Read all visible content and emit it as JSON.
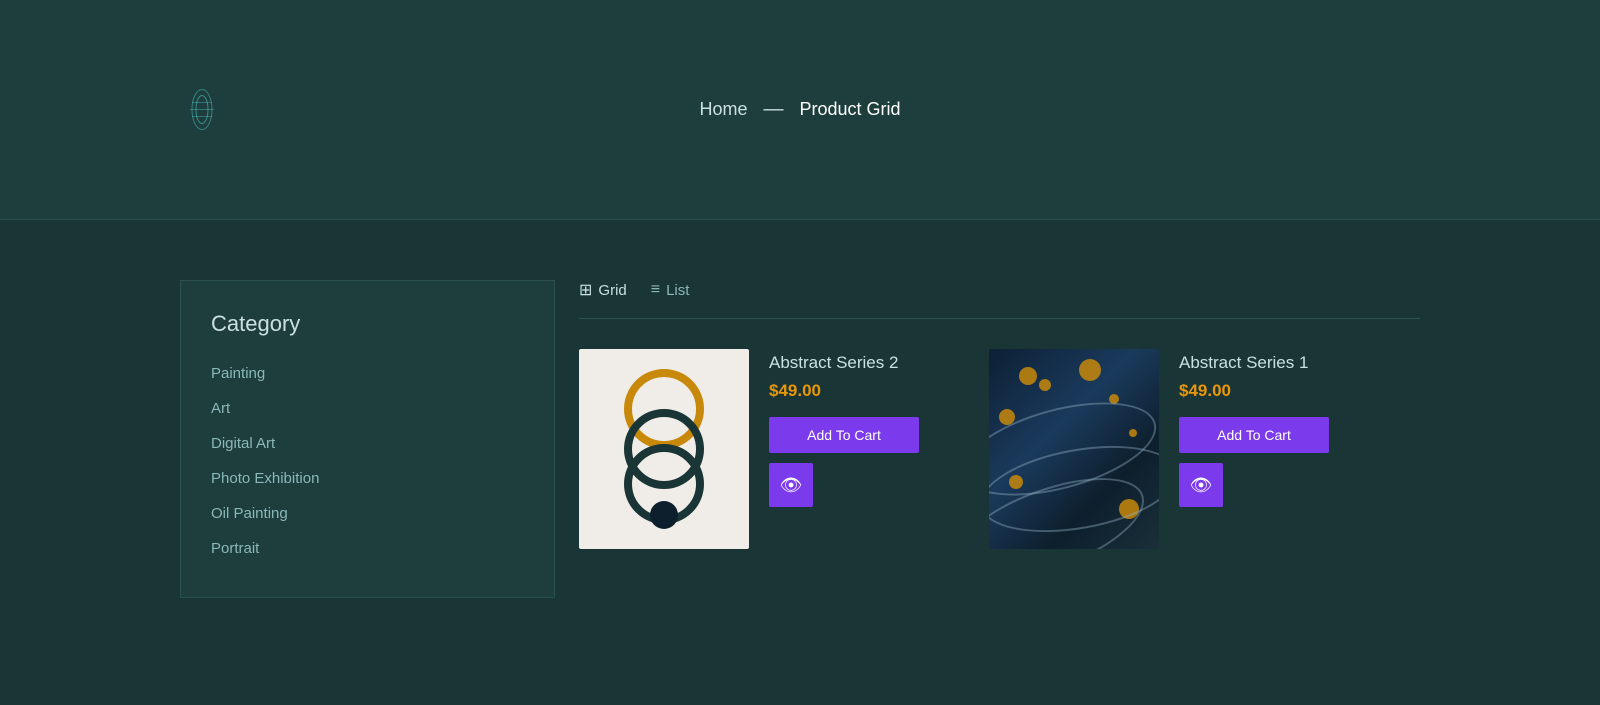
{
  "hero": {
    "logo_alt": "Site Logo",
    "breadcrumb": {
      "home_label": "Home",
      "separator": "—",
      "current_label": "Product Grid"
    }
  },
  "sidebar": {
    "title": "Category",
    "categories": [
      {
        "label": "Painting"
      },
      {
        "label": "Art"
      },
      {
        "label": "Digital Art"
      },
      {
        "label": "Photo Exhibition"
      },
      {
        "label": "Oil Painting"
      },
      {
        "label": "Portrait"
      }
    ]
  },
  "product_area": {
    "view_grid_label": "Grid",
    "view_list_label": "List",
    "products": [
      {
        "name": "Abstract Series 2",
        "price": "$49.00",
        "add_to_cart_label": "Add To Cart",
        "image_type": "rings"
      },
      {
        "name": "Abstract Series 1",
        "price": "$49.00",
        "add_to_cart_label": "Add To Cart",
        "image_type": "ocean"
      }
    ]
  }
}
